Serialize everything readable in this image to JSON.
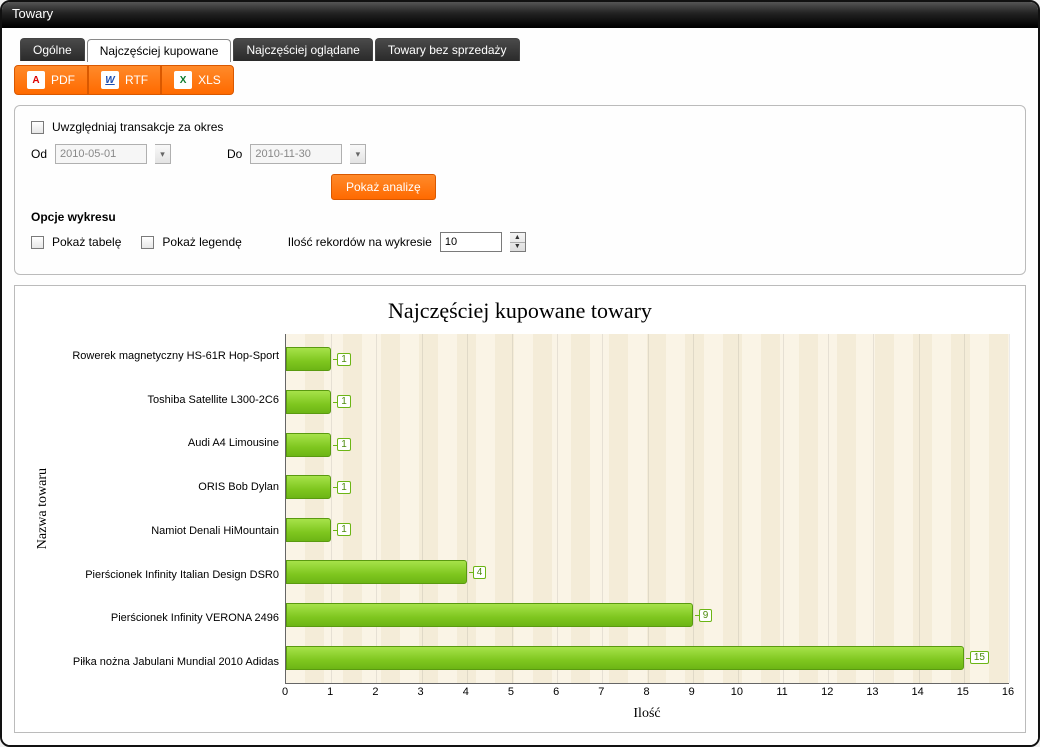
{
  "window": {
    "title": "Towary"
  },
  "tabs": [
    {
      "label": "Ogólne",
      "active": false
    },
    {
      "label": "Najczęściej kupowane",
      "active": true
    },
    {
      "label": "Najczęściej oglądane",
      "active": false
    },
    {
      "label": "Towary bez sprzedaży",
      "active": false
    }
  ],
  "export": {
    "pdf": "PDF",
    "rtf": "RTF",
    "xls": "XLS"
  },
  "options": {
    "include_transactions_label": "Uwzględniaj transakcje za okres",
    "from_label": "Od",
    "to_label": "Do",
    "from_value": "2010-05-01",
    "to_value": "2010-11-30",
    "show_analysis_label": "Pokaż analizę",
    "chart_options_title": "Opcje wykresu",
    "show_table_label": "Pokaż tabelę",
    "show_legend_label": "Pokaż legendę",
    "records_label": "Ilość rekordów na wykresie",
    "records_value": "10"
  },
  "chart_data": {
    "type": "bar",
    "orientation": "horizontal",
    "title": "Najczęściej kupowane towary",
    "xlabel": "Ilość",
    "ylabel": "Nazwa towaru",
    "xlim": [
      0,
      16
    ],
    "xticks": [
      0,
      1,
      2,
      3,
      4,
      5,
      6,
      7,
      8,
      9,
      10,
      11,
      12,
      13,
      14,
      15,
      16
    ],
    "categories": [
      "Rowerek magnetyczny HS-61R Hop-Sport",
      "Toshiba Satellite L300-2C6",
      "Audi A4 Limousine",
      "ORIS Bob Dylan",
      "Namiot Denali HiMountain",
      "Pierścionek Infinity Italian Design DSR0",
      "Pierścionek Infinity VERONA 2496",
      "Piłka nożna Jabulani Mundial 2010 Adidas"
    ],
    "values": [
      1,
      1,
      1,
      1,
      1,
      4,
      9,
      15
    ]
  }
}
